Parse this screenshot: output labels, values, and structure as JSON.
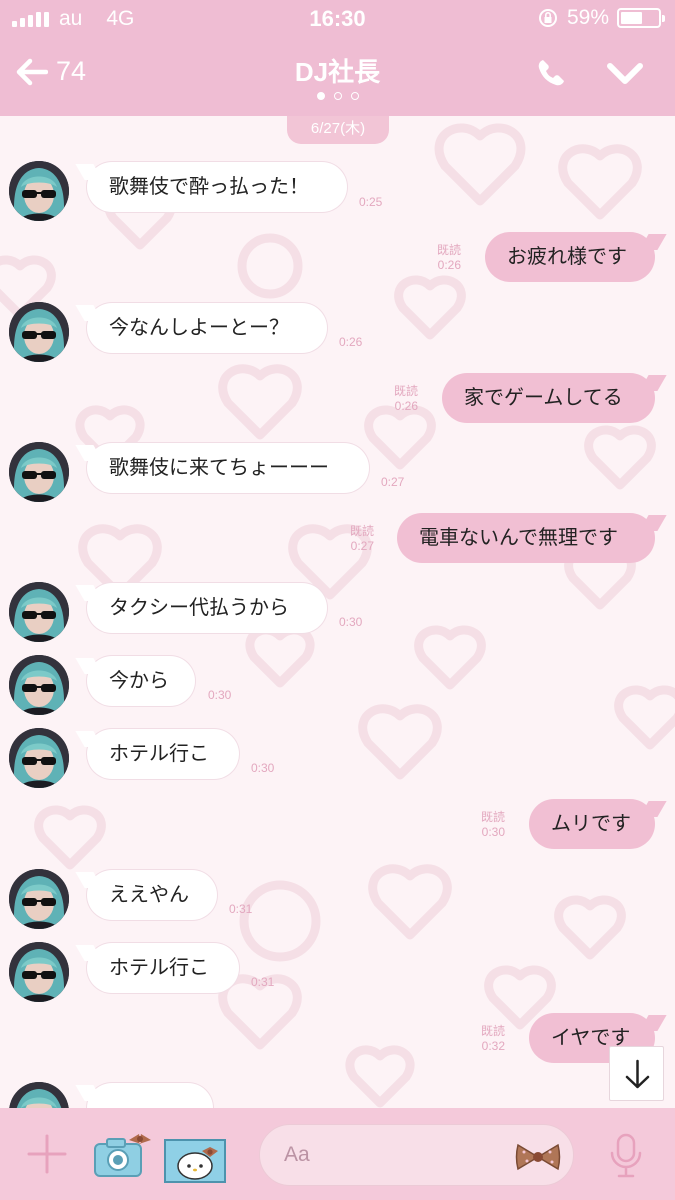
{
  "status_bar": {
    "carrier": "au",
    "network": "4G",
    "time": "16:30",
    "battery": "59%",
    "battery_level": 0.59
  },
  "header": {
    "back_count": "74",
    "title": "DJ社長"
  },
  "chat": {
    "date_label": "6/27(木)",
    "messages": [
      {
        "dir": "in",
        "text": "歌舞伎で酔っ払った！",
        "time": "0:25"
      },
      {
        "dir": "out",
        "text": "お疲れ様です",
        "read": "既読",
        "time": "0:26"
      },
      {
        "dir": "in",
        "text": "今なんしよーとー？",
        "time": "0:26"
      },
      {
        "dir": "out",
        "text": "家でゲームしてる",
        "read": "既読",
        "time": "0:26"
      },
      {
        "dir": "in",
        "text": "歌舞伎に来てちょーーー",
        "time": "0:27"
      },
      {
        "dir": "out",
        "text": "電車ないんで無理です",
        "read": "既読",
        "time": "0:27"
      },
      {
        "dir": "in",
        "text": "タクシー代払うから",
        "time": "0:30"
      },
      {
        "dir": "in",
        "text": "今から",
        "time": "0:30"
      },
      {
        "dir": "in",
        "text": "ホテル行こ",
        "time": "0:30"
      },
      {
        "dir": "out",
        "text": "ムリです",
        "read": "既読",
        "time": "0:30"
      },
      {
        "dir": "in",
        "text": "ええやん",
        "time": "0:31"
      },
      {
        "dir": "in",
        "text": "ホテル行こ",
        "time": "0:31"
      },
      {
        "dir": "out",
        "text": "イヤです",
        "read": "既読",
        "time": "0:32"
      },
      {
        "dir": "in",
        "text": "",
        "time": ""
      }
    ]
  },
  "input": {
    "placeholder": "Aa"
  },
  "colors": {
    "accent": "#efbdd3",
    "outgoing_bubble": "#f1bfd3",
    "meta_text": "#e3a8bf"
  },
  "icons": [
    "back-arrow-icon",
    "phone-icon",
    "chevron-down-icon",
    "scroll-down-icon",
    "plus-icon",
    "camera-icon",
    "photo-icon",
    "bow-sticker-icon",
    "mic-icon"
  ]
}
